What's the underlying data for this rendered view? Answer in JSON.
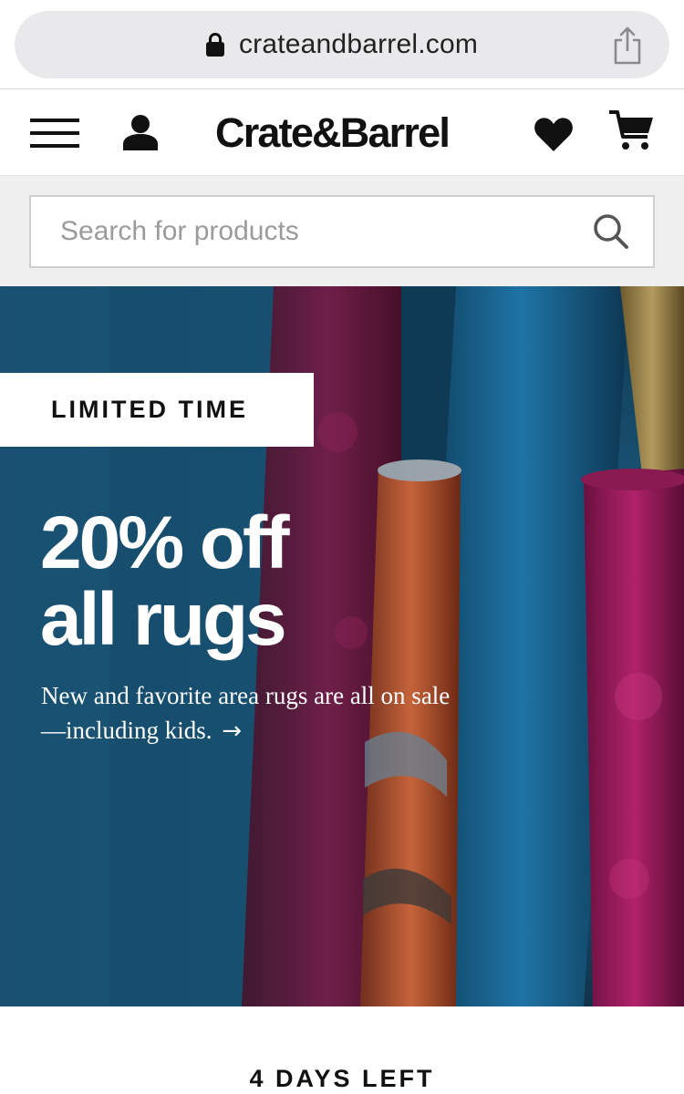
{
  "browser": {
    "url": "crateandbarrel.com",
    "lock_icon": "lock-icon",
    "share_icon": "share-icon"
  },
  "header": {
    "logo": "Crate&Barrel",
    "icons": [
      "menu-icon",
      "account-icon",
      "heart-icon",
      "cart-icon"
    ]
  },
  "search": {
    "placeholder": "Search for products",
    "value": "",
    "icon": "search-icon"
  },
  "hero": {
    "badge": "LIMITED TIME",
    "headline_line1": "20% off",
    "headline_line2": "all rugs",
    "subtext": "New and favorite area rugs are all on sale—including kids.",
    "arrow": "→"
  },
  "countdown": {
    "text": "4 DAYS LEFT"
  },
  "colors": {
    "hero_blue": "#1c5f86",
    "rug_magenta": "#8a1f4e",
    "rug_rust": "#b0522f"
  }
}
